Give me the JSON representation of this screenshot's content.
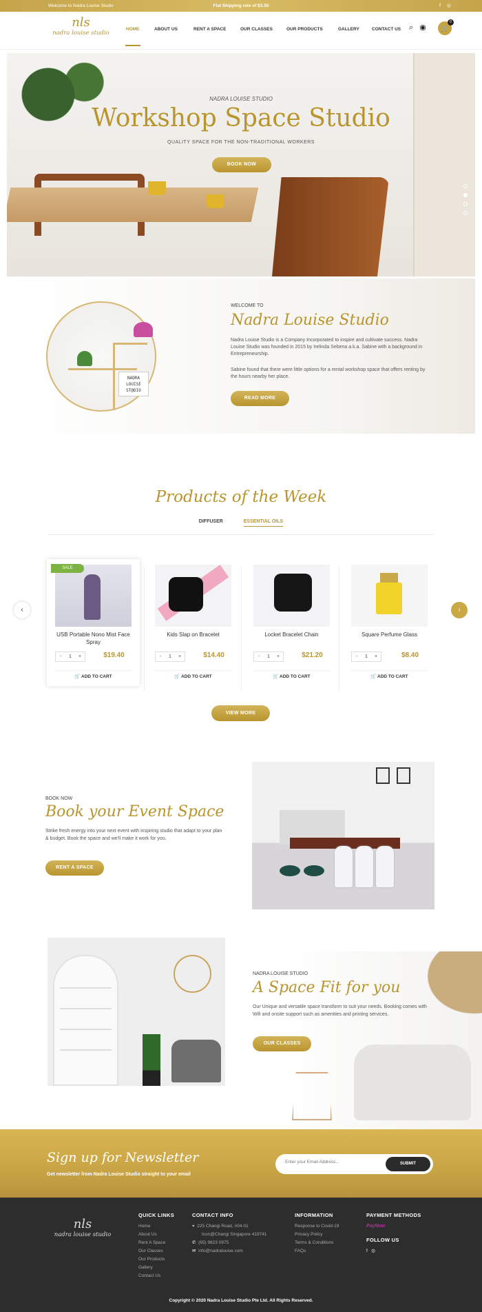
{
  "topbar": {
    "welcome": "Welcome to Nadra Louise Studio",
    "shipping": "Flat Shipping rate of $3.50",
    "social_fb": "f",
    "social_ig": "◎"
  },
  "logo": {
    "mark": "nls",
    "name": "nadra louise studio"
  },
  "nav": [
    "HOME",
    "ABOUT US",
    "RENT A SPACE",
    "OUR CLASSES",
    "OUR PRODUCTS",
    "GALLERY",
    "CONTACT US"
  ],
  "cart": {
    "count": "0"
  },
  "hero": {
    "subtitle": "NADRA LOUISE STUDIO",
    "title": "Workshop Space Studio",
    "tagline": "QUALITY SPACE FOR THE NON-TRADITIONAL WORKERS",
    "button": "BOOK NOW"
  },
  "welcome": {
    "pre": "WELCOME TO",
    "title": "Nadra Louise Studio",
    "p1": "Nadra Louise Studio is a Company Incorporated to inspire and cultivate success. Nadra Louise Studio was founded in 2015 by Irelinda Sebena a.k.a. Sabine with a background in Entrepreneurship.",
    "p2": "Sabine found that there were little options for a rental workshop space that offers renting by the hours nearby her place.",
    "button": "READ MORE",
    "sign": [
      "NADRA",
      "LOUISE",
      "ST@DIO"
    ]
  },
  "products": {
    "title": "Products of the Week",
    "tabs": [
      "DIFFUSER",
      "ESSENTIAL OILS"
    ],
    "items": [
      {
        "name": "USB Portable Nono Mist Face Spray",
        "price": "$19.40",
        "qty": "1",
        "badge": "SALE"
      },
      {
        "name": "Kids Slap on Bracelet",
        "price": "$14.40",
        "qty": "1"
      },
      {
        "name": "Locket Bracelet Chain",
        "price": "$21.20",
        "qty": "1"
      },
      {
        "name": "Square Perfume Glass",
        "price": "$8.40",
        "qty": "1"
      }
    ],
    "add_to_cart": "ADD TO CART",
    "view_more": "VIEW MORE"
  },
  "event": {
    "pre": "BOOK NOW",
    "title": "Book your Event Space",
    "text": "Strike fresh energy into your next event with inspiring studio that adapt to your plan & budget. Book the space and we'll make it work for you.",
    "button": "RENT A SPACE"
  },
  "fit": {
    "pre": "NADRA LOUISE STUDIO",
    "title": "A Space Fit for you",
    "text": "Our Unique and versatile space transform to suit your needs. Booking comes with Wifi and onsite support such as amenities and printing services.",
    "button": "OUR CLASSES"
  },
  "newsletter": {
    "title": "Sign up for Newsletter",
    "text": "Get newsletter from Nadra Louise Studio straight to your email",
    "placeholder": "Enter your Email Address...",
    "button": "SUBMIT"
  },
  "footer": {
    "quick_title": "QUICK LINKS",
    "quick_links": [
      "Home",
      "About Us",
      "Rent A Space",
      "Our Classes",
      "Our Products",
      "Gallery",
      "Contact Us"
    ],
    "contact_title": "CONTACT INFO",
    "address1": "225 Changi Road, #04-01",
    "address2": "Icon@Changi Singapore 419741",
    "phone": "(65) 9823 0975",
    "email": "info@nadralouise.com",
    "info_title": "INFORMATION",
    "info_links": [
      "Response to Covid-19",
      "Privacy Policy",
      "Terms & Conditions",
      "FAQs"
    ],
    "payment_title": "PAYMENT METHODS",
    "payment": "PayNow",
    "follow_title": "FOLLOW US",
    "copyright": "Copyright © 2020 Nadra Louise Studio Pte Ltd. All Rights Reserved."
  }
}
